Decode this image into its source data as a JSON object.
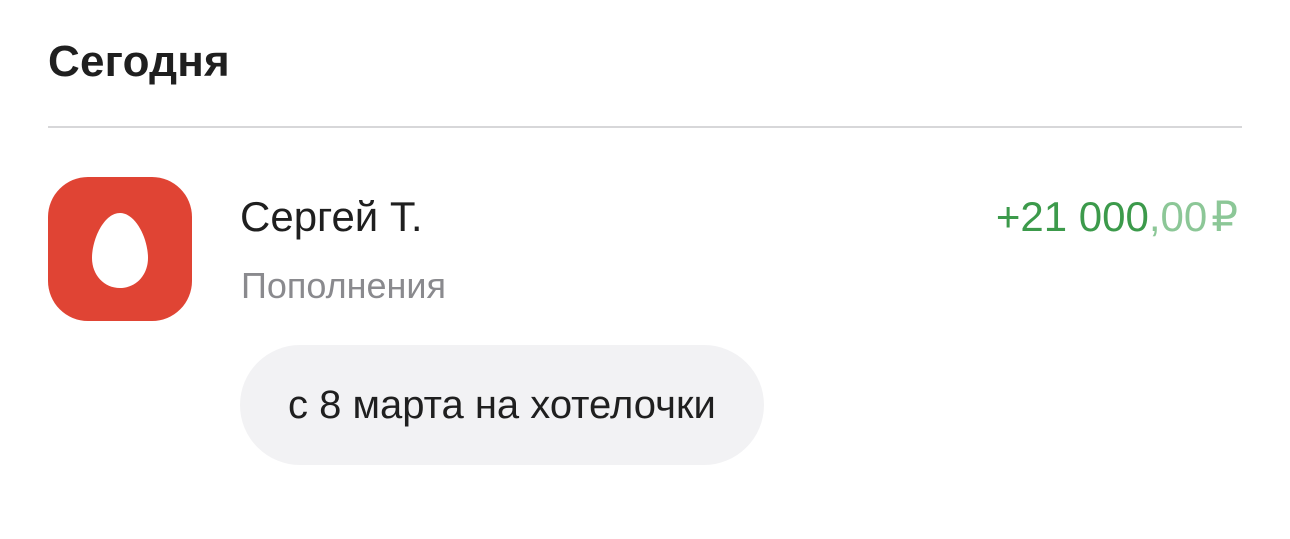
{
  "section": {
    "title": "Сегодня"
  },
  "transaction": {
    "icon": "egg-logo-icon",
    "icon_color": "#e04434",
    "payer_name": "Сергей Т.",
    "category": "Пополнения",
    "amount": {
      "whole": "+21 000",
      "fraction": ",00",
      "currency": "₽",
      "color": "#3c9a4b"
    },
    "comment": "с 8 марта на хотелочки"
  }
}
